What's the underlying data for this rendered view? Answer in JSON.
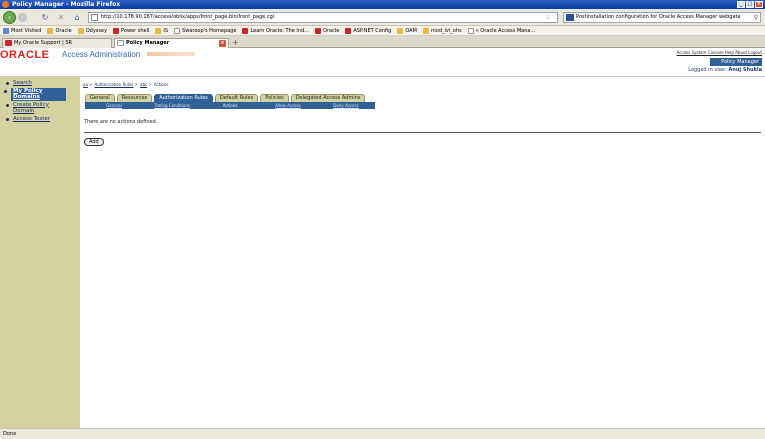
{
  "window": {
    "title": "Policy Manager - Mozilla Firefox"
  },
  "browser": {
    "url": "http://10.178.90.167/access/oblix/apps/front_page.bin/front_page.cgi",
    "search_value": "Postinstallation configuration for Oracle Access Manager webgate",
    "bookmarks": [
      "Most Visited",
      "Oracle",
      "Odyssey",
      "Power shell",
      "IS",
      "Swaroop's Homepage",
      "Learn Oracle: The Ind...",
      "Oracle",
      "ASP.NET Config",
      "OAM",
      "mod_ivl_ohs",
      "» Oracle Access Mana..."
    ],
    "tabs": [
      "My Oracle Support | SR",
      "Policy Manager"
    ],
    "status": "Done"
  },
  "header": {
    "logo": "ORACLE",
    "app_title": "Access Administration",
    "top_links": "Access System Console Help About Logout",
    "badge": "Policy Manager",
    "logged_in_label": "Logged in user:",
    "user": "Anuj Shukla"
  },
  "leftnav": {
    "items": [
      "Search",
      "My Policy Domains",
      "Create Policy Domain",
      "Access Tester"
    ]
  },
  "main": {
    "breadcrumb": [
      "aa",
      "Authorization Rules",
      "abc",
      "Actions"
    ],
    "tabs": [
      "General",
      "Resources",
      "Authorization Rules",
      "Default Rules",
      "Policies",
      "Delegated Access Admins"
    ],
    "subtabs": [
      "General",
      "Timing Conditions",
      "Actions",
      "Allow Access",
      "Deny Access"
    ],
    "message": "There are no actions defined.",
    "add_label": "Add"
  }
}
